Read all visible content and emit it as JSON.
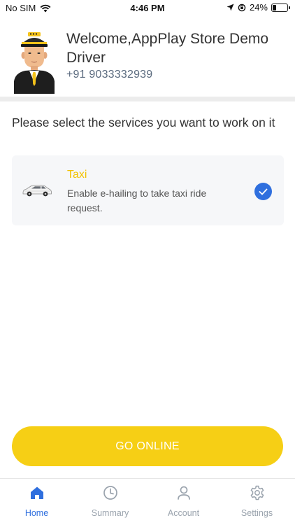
{
  "status_bar": {
    "carrier": "No SIM",
    "time": "4:46 PM",
    "battery": "24%",
    "battery_level": 0.24
  },
  "header": {
    "welcome": "Welcome,AppPlay Store Demo Driver",
    "phone": "+91 9033332939"
  },
  "services": {
    "prompt": "Please select the services you want to work on it",
    "items": [
      {
        "title": "Taxi",
        "description": "Enable e-hailing to take taxi ride request.",
        "selected": true
      }
    ]
  },
  "go_online": {
    "label": "GO ONLINE"
  },
  "nav": {
    "items": [
      {
        "label": "Home",
        "icon": "home-icon",
        "active": true
      },
      {
        "label": "Summary",
        "icon": "clock-icon",
        "active": false
      },
      {
        "label": "Account",
        "icon": "user-icon",
        "active": false
      },
      {
        "label": "Settings",
        "icon": "gear-icon",
        "active": false
      }
    ]
  },
  "colors": {
    "accent_yellow": "#f6cf15",
    "taxi_title": "#f2c200",
    "active_blue": "#2f6fde",
    "inactive_gray": "#9aa3ad"
  }
}
